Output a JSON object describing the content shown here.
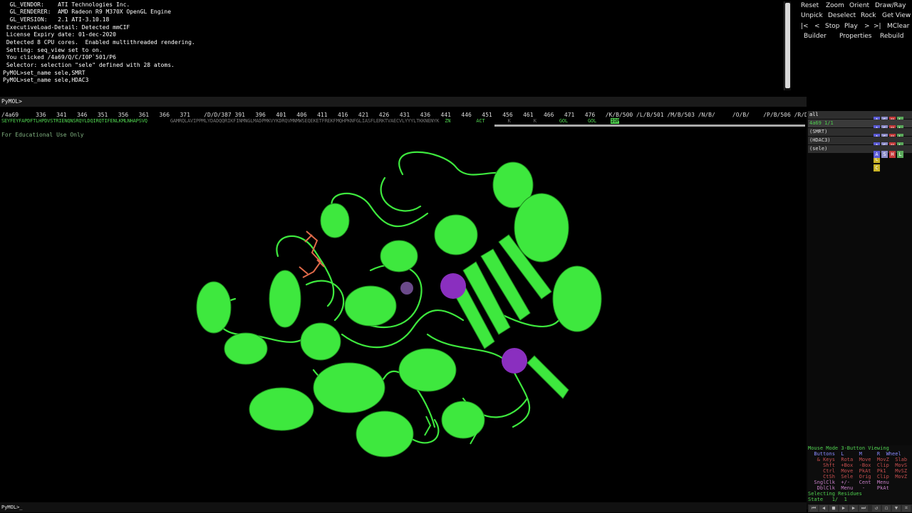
{
  "log": {
    "lines": [
      "  GL_VENDOR:    ATI Technologies Inc.",
      "  GL_RENDERER:  AMD Radeon R9 M370X OpenGL Engine",
      "  GL_VERSION:   2.1 ATI-3.10.18",
      " ExecutiveLoad-Detail: Detected mmCIF",
      " License Expiry date: 01-dec-2020",
      " Detected 8 CPU cores.  Enabled multithreaded rendering.",
      " Setting: seq_view set to on.",
      " You clicked /4a69/Q/C/I0P`501/P6",
      " Selector: selection \"sele\" defined with 28 atoms.",
      "PyMOL>set_name sele,SMRT",
      "PyMOL>set_name sele,HDAC3"
    ]
  },
  "toolbar": {
    "reset": "Reset",
    "zoom": "Zoom",
    "orient": "Orient",
    "drawray": "Draw/Ray",
    "unpick": "Unpick",
    "deselect": "Deselect",
    "rock": "Rock",
    "getview": "Get View",
    "first": "|<",
    "prev": "<",
    "stop": "Stop",
    "play": "Play",
    "next": ">",
    "last": ">|",
    "mclear": "MClear",
    "builder": "Builder",
    "properties": "Properties",
    "rebuild": "Rebuild"
  },
  "command": {
    "prompt": "PyMOL>",
    "value": ""
  },
  "sequence": {
    "numbers": "/4a69     336   341   346   351   356   361   366   371    /D/D/387 391   396   401   406   411   416   421   426   431   436   441   446   451   456   461   466   471   476   /K/B/500 /L/B/501 /M/B/503 /N/B/     /O/B/    /P/B/506 /R/D/501",
    "residues_a": "SEYFEYFAPDFTLHPDVSTRIENQNSRQYLDQIRQTIFENLKMLNHAPSVQ",
    "residues_b": "GAMRQLAVIPPMLYDADQQRIKFINMNGLMADPMKVYKDRQVMNMWSEQEKETFREKFMQHPKNFGLIASFLERKTVAECVLYYYLTKKNENYK",
    "het_zn": "ZN",
    "het_act": "ACT",
    "het_k1": "K",
    "het_k2": "K",
    "het_gol1": "GOL",
    "het_gol2": "GOL",
    "het_iop": "IOP"
  },
  "objects": [
    {
      "name": "all",
      "extra": ""
    },
    {
      "name": "4a69",
      "extra": "1/1"
    },
    {
      "name": "(SMRT)",
      "extra": ""
    },
    {
      "name": "(HDAC3)",
      "extra": ""
    },
    {
      "name": "(sele)",
      "extra": ""
    }
  ],
  "object_buttons": {
    "a": "A",
    "s": "S",
    "h": "H",
    "l": "L",
    "c": "C"
  },
  "viewport": {
    "watermark": "For Educational Use Only"
  },
  "mouse": {
    "mode_title": "Mouse Mode 3-Button Viewing",
    "buttons_row": "  Buttons  L     M     R  Wheel",
    "keys_row": "   & Keys  Rota  Move  MovZ  Slab",
    "shft_row": "     Shft  +Box  -Box  Clip  MovS",
    "ctrl_row": "     Ctrl  Move  PkAt  Pk1   MvSZ",
    "ctsh_row": "     CtSh  Sele  Orig  Clip  MovZ",
    "sngl_row": "  SnglClk  +/-   Cent  Menu",
    "dbl_row": "   DblClk  Menu   -    PkAt",
    "selecting": "Selecting Residues",
    "state": "State   1/  1"
  },
  "bottom": {
    "prompt": "PyMOL>_",
    "value": ""
  },
  "colors": {
    "cartoon": "#3ee83e",
    "sphere": "#8a2fbf",
    "seq": "#4fd14f"
  }
}
